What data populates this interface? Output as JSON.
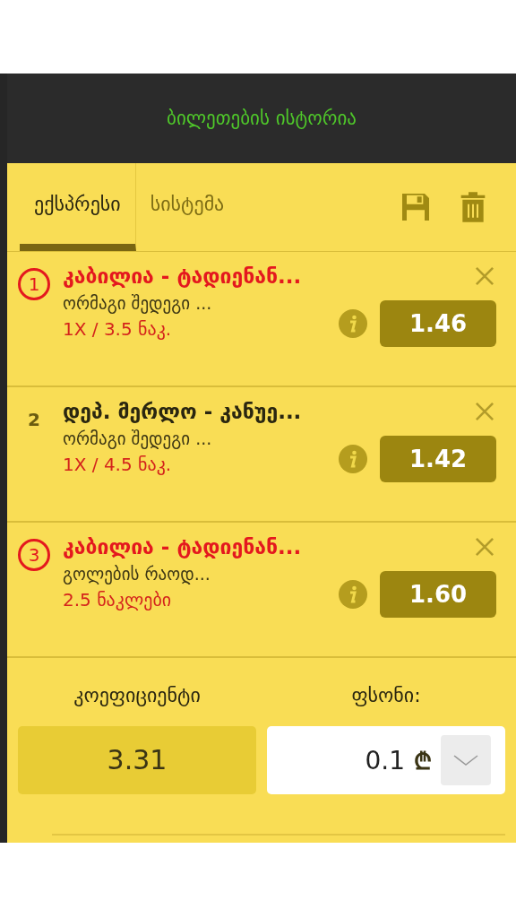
{
  "header": {
    "title": "ბილეთების ისტორია"
  },
  "tabs": [
    {
      "label": "ექსპრესი",
      "selected": true
    },
    {
      "label": "სისტემა",
      "selected": false
    }
  ],
  "bets": [
    {
      "number": "1",
      "conflict": true,
      "match": "კაბილია - ტადიენან...",
      "market": "ორმაგი შედეგი ...",
      "pick": "1X / 3.5 ნაკ.",
      "odds": "1.46"
    },
    {
      "number": "2",
      "conflict": false,
      "match": "დეპ. მერლო - კანუე...",
      "market": "ორმაგი შედეგი ...",
      "pick": "1X / 4.5 ნაკ.",
      "odds": "1.42"
    },
    {
      "number": "3",
      "conflict": true,
      "match": "კაბილია - ტადიენან...",
      "market": "გოლების რაოდ...",
      "pick": "2.5 ნაკლები",
      "odds": "1.60"
    }
  ],
  "summary": {
    "odds_label": "კოეფიციენტი",
    "odds_value": "3.31",
    "stake_label": "ფსონი:",
    "stake_value": "0.1",
    "currency": "₾"
  }
}
